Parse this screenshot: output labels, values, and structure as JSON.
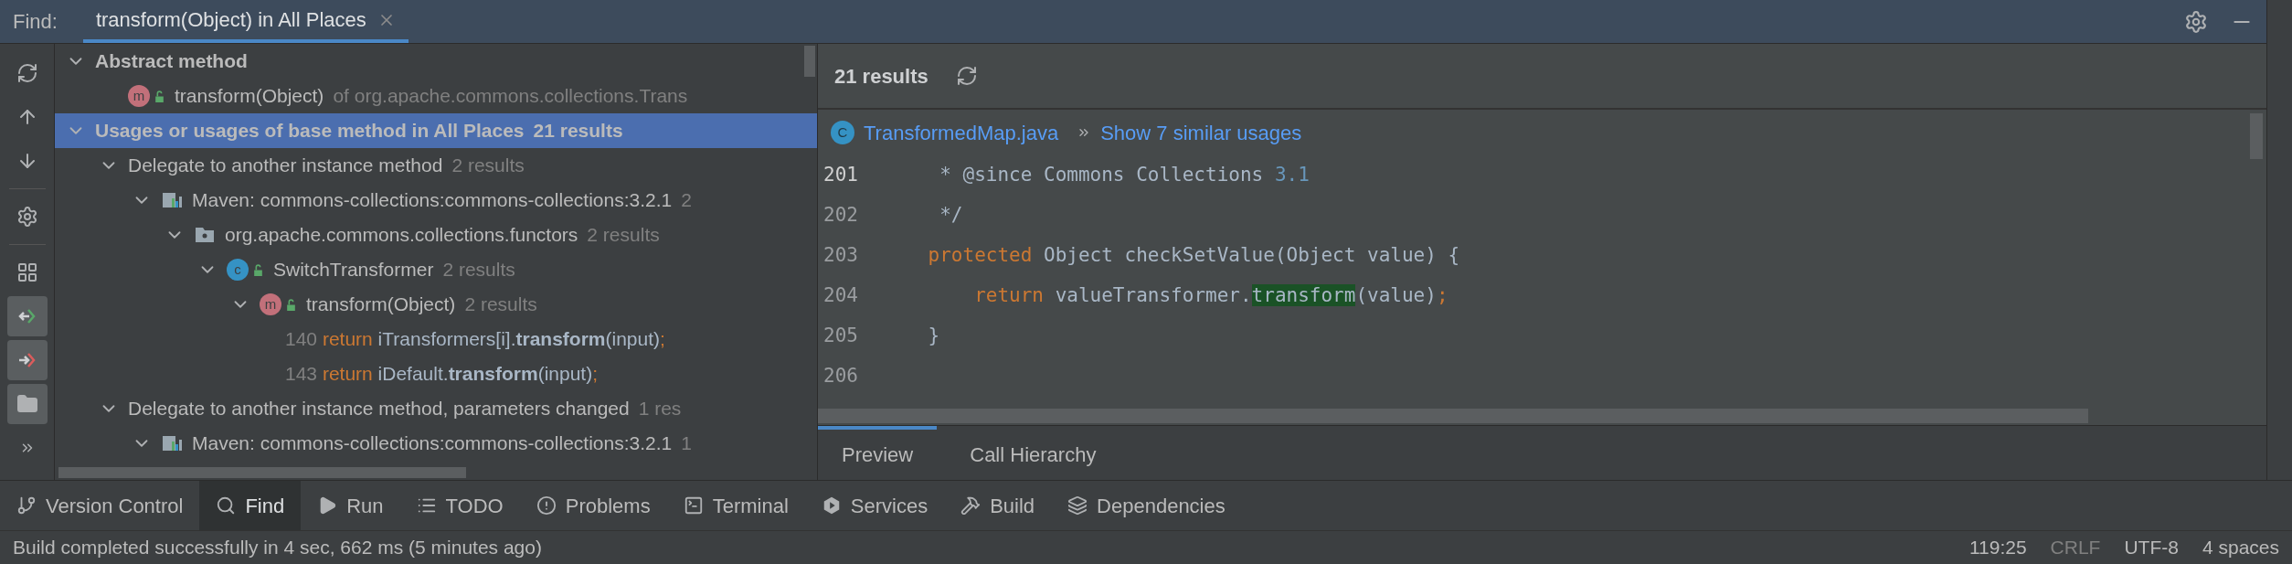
{
  "find_bar": {
    "label": "Find:",
    "tab": {
      "title": "transform(Object) in All Places",
      "selected": true
    }
  },
  "toolbar": [
    {
      "kind": "rerun",
      "on": false
    },
    {
      "kind": "up",
      "on": false
    },
    {
      "kind": "down",
      "on": false
    },
    {
      "kind": "settings",
      "on": false
    },
    {
      "kind": "group",
      "on": false
    },
    {
      "kind": "merge",
      "on": true
    },
    {
      "kind": "export",
      "on": true
    },
    {
      "kind": "folder",
      "on": true
    },
    {
      "kind": "more",
      "on": false
    }
  ],
  "tree": [
    {
      "kind": "group",
      "text": "Abstract method",
      "expanded": true,
      "selected": false,
      "children": [
        {
          "kind": "method",
          "badge": "m",
          "text": "transform(Object)",
          "detail": "of org.apache.commons.collections.Trans",
          "selected": false
        }
      ]
    },
    {
      "kind": "group",
      "text": "Usages or usages of base method in All Places",
      "count": "21 results",
      "expanded": true,
      "selected": true,
      "children": [
        {
          "kind": "category",
          "text": "Delegate to another instance method",
          "count": "2 results",
          "expanded": true,
          "selected": false,
          "children": [
            {
              "kind": "library",
              "text": "Maven: commons-collections:commons-collections:3.2.1",
              "count": "2",
              "expanded": true,
              "selected": false,
              "children": [
                {
                  "kind": "package",
                  "text": "org.apache.commons.collections.functors",
                  "count": "2 results",
                  "expanded": true,
                  "selected": false,
                  "children": [
                    {
                      "kind": "class",
                      "badge": "c",
                      "text": "SwitchTransformer",
                      "count": "2 results",
                      "expanded": true,
                      "selected": false,
                      "children": [
                        {
                          "kind": "method",
                          "badge": "m",
                          "text": "transform(Object)",
                          "count": "2 results",
                          "expanded": true,
                          "selected": false,
                          "children": [
                            {
                              "kind": "usage",
                              "line": "140",
                              "selected": false,
                              "tokens": [
                                {
                                  "kind": "keyword",
                                  "text": "return"
                                },
                                {
                                  "kind": "plain",
                                  "text": " iTransformers[i]."
                                },
                                {
                                  "kind": "match",
                                  "text": "transform"
                                },
                                {
                                  "kind": "plain",
                                  "text": "(input)"
                                },
                                {
                                  "kind": "keyword",
                                  "text": ";"
                                }
                              ]
                            },
                            {
                              "kind": "usage",
                              "line": "143",
                              "selected": false,
                              "tokens": [
                                {
                                  "kind": "keyword",
                                  "text": "return"
                                },
                                {
                                  "kind": "plain",
                                  "text": " iDefault."
                                },
                                {
                                  "kind": "match",
                                  "text": "transform"
                                },
                                {
                                  "kind": "plain",
                                  "text": "(input)"
                                },
                                {
                                  "kind": "keyword",
                                  "text": ";"
                                }
                              ]
                            }
                          ]
                        }
                      ]
                    }
                  ]
                }
              ]
            }
          ]
        },
        {
          "kind": "category",
          "text": "Delegate to another instance method, parameters changed",
          "count": "1 res",
          "expanded": true,
          "selected": false,
          "children": [
            {
              "kind": "library",
              "text": "Maven: commons-collections:commons-collections:3.2.1",
              "count": "1",
              "expanded": true,
              "selected": false
            }
          ]
        }
      ]
    }
  ],
  "preview": {
    "summary": "21 results",
    "file_badge": "C",
    "file": "TransformedMap.java",
    "similar": "Show 7 similar usages",
    "lines": [
      {
        "line": "201",
        "current": true,
        "tokens": [
          {
            "kind": "plain",
            "text": "     * @since Commons Collections "
          },
          {
            "kind": "number",
            "text": "3.1"
          }
        ]
      },
      {
        "line": "202",
        "current": false,
        "tokens": [
          {
            "kind": "plain",
            "text": "     */"
          }
        ]
      },
      {
        "line": "203",
        "current": false,
        "tokens": [
          {
            "kind": "keyword",
            "text": "    protected"
          },
          {
            "kind": "plain",
            "text": " Object checkSetValue(Object value) {"
          }
        ]
      },
      {
        "line": "204",
        "current": false,
        "tokens": [
          {
            "kind": "keyword",
            "text": "        return"
          },
          {
            "kind": "plain",
            "text": " valueTransformer."
          },
          {
            "kind": "match",
            "text": "transform"
          },
          {
            "kind": "plain",
            "text": "(value)"
          },
          {
            "kind": "keyword",
            "text": ";"
          }
        ]
      },
      {
        "line": "205",
        "current": false,
        "tokens": [
          {
            "kind": "plain",
            "text": "    }"
          }
        ]
      },
      {
        "line": "206",
        "current": false
      }
    ],
    "tabs": [
      {
        "label": "Preview",
        "selected": true
      },
      {
        "label": "Call Hierarchy",
        "selected": false
      }
    ]
  },
  "tool_tabs": [
    {
      "kind": "vcs",
      "label": "Version Control",
      "selected": false
    },
    {
      "kind": "find",
      "label": "Find",
      "selected": true
    },
    {
      "kind": "run",
      "label": "Run",
      "selected": false
    },
    {
      "kind": "todo",
      "label": "TODO",
      "selected": false
    },
    {
      "kind": "problems",
      "label": "Problems",
      "selected": false
    },
    {
      "kind": "terminal",
      "label": "Terminal",
      "selected": false
    },
    {
      "kind": "services",
      "label": "Services",
      "selected": false
    },
    {
      "kind": "build",
      "label": "Build",
      "selected": false
    },
    {
      "kind": "dependencies",
      "label": "Dependencies",
      "selected": false
    }
  ],
  "status_bar": {
    "message": "Build completed successfully in 4 sec, 662 ms (5 minutes ago)",
    "position": "119:25",
    "line_ending": "CRLF",
    "encoding": "UTF-8",
    "indent": "4 spaces"
  }
}
